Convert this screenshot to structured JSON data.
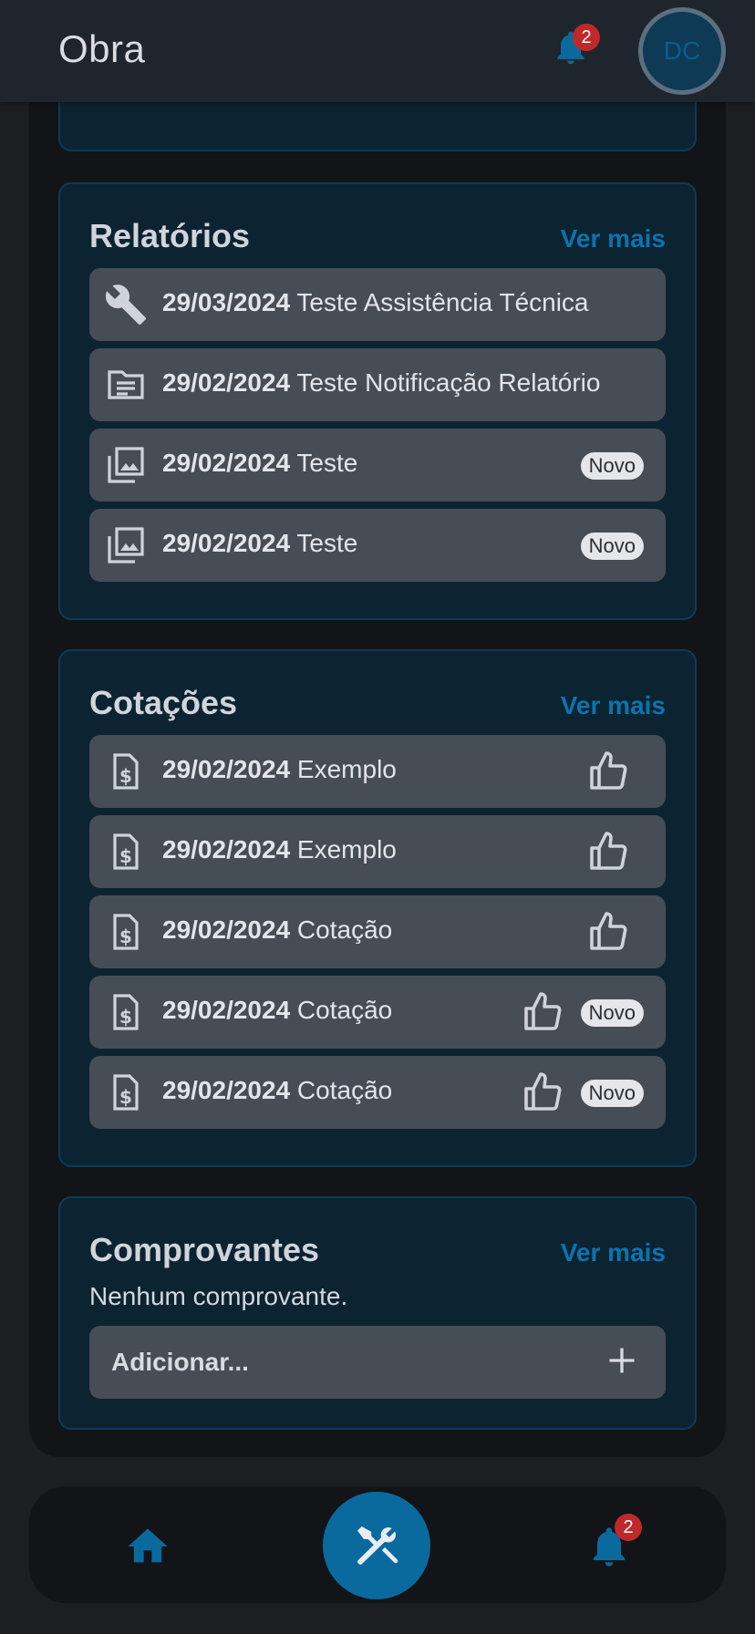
{
  "header": {
    "title": "Obra",
    "notification_count": "2",
    "avatar_initials": "DC"
  },
  "relatorios": {
    "title": "Relatórios",
    "more": "Ver mais",
    "items": [
      {
        "date": "29/03/2024",
        "text": "Teste Assistência Técnica",
        "icon": "wrench-icon",
        "badge": ""
      },
      {
        "date": "29/02/2024",
        "text": "Teste Notificação Relatório",
        "icon": "document-icon",
        "badge": ""
      },
      {
        "date": "29/02/2024",
        "text": "Teste",
        "icon": "photo-gallery-icon",
        "badge": "Novo"
      },
      {
        "date": "29/02/2024",
        "text": "Teste",
        "icon": "photo-gallery-icon",
        "badge": "Novo"
      }
    ]
  },
  "cotacoes": {
    "title": "Cotações",
    "more": "Ver mais",
    "items": [
      {
        "date": "29/02/2024",
        "text": "Exemplo",
        "icon": "invoice-dollar-icon",
        "badge": ""
      },
      {
        "date": "29/02/2024",
        "text": "Exemplo",
        "icon": "invoice-dollar-icon",
        "badge": ""
      },
      {
        "date": "29/02/2024",
        "text": "Cotação",
        "icon": "invoice-dollar-icon",
        "badge": ""
      },
      {
        "date": "29/02/2024",
        "text": "Cotação",
        "icon": "invoice-dollar-icon",
        "badge": "Novo"
      },
      {
        "date": "29/02/2024",
        "text": "Cotação",
        "icon": "invoice-dollar-icon",
        "badge": "Novo"
      }
    ]
  },
  "comprovantes": {
    "title": "Comprovantes",
    "more": "Ver mais",
    "empty": "Nenhum comprovante.",
    "add_label": "Adicionar..."
  },
  "bottom_nav": {
    "notification_count": "2",
    "icons": [
      "home-icon",
      "tools-icon",
      "bell-icon"
    ]
  },
  "colors": {
    "accent": "#0b74ae",
    "card_bg": "#0c2332",
    "row_bg": "#474d55",
    "badge_red": "#c0282b"
  }
}
